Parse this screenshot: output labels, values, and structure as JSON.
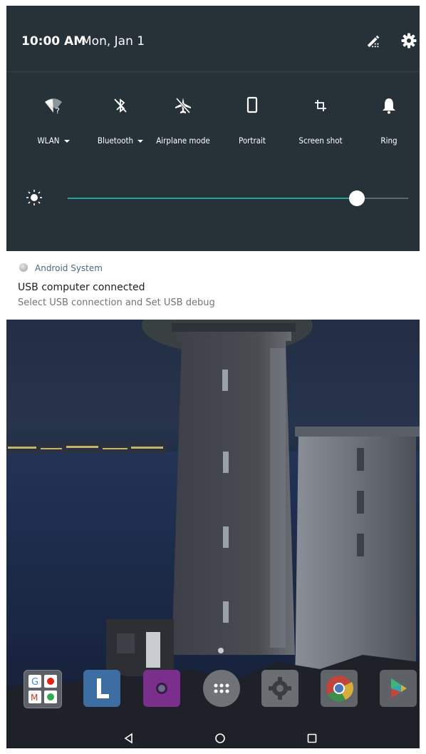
{
  "status": {
    "time": "10:00 AM",
    "date": "Mon, Jan 1"
  },
  "header_icons": [
    "edit-icon",
    "gear-icon"
  ],
  "tiles": [
    {
      "label": "WLAN",
      "icon": "wifi-unknown-icon",
      "dropdown": true
    },
    {
      "label": "Bluetooth",
      "icon": "bluetooth-off-icon",
      "dropdown": true
    },
    {
      "label": "Airplane mode",
      "icon": "airplane-off-icon",
      "dropdown": false
    },
    {
      "label": "Portrait",
      "icon": "portrait-icon",
      "dropdown": false
    },
    {
      "label": "Screen shot",
      "icon": "crop-icon",
      "dropdown": false
    },
    {
      "label": "Ring",
      "icon": "bell-icon",
      "dropdown": false
    }
  ],
  "brightness": {
    "icon": "brightness-icon",
    "level": 0.85
  },
  "notification": {
    "app": "Android System",
    "title": "USB computer connected",
    "text": "Select USB connection and Set USB debug"
  },
  "dock": [
    {
      "name": "google-folder"
    },
    {
      "name": "l-app"
    },
    {
      "name": "camera-app"
    },
    {
      "name": "app-drawer"
    },
    {
      "name": "settings-app"
    },
    {
      "name": "chrome-app"
    },
    {
      "name": "play-store-app"
    }
  ],
  "nav": [
    "back-icon",
    "home-icon",
    "recents-icon"
  ],
  "colors": {
    "panel": "#263238",
    "accent": "#26a69a",
    "notification_app": "#4a6a86"
  }
}
